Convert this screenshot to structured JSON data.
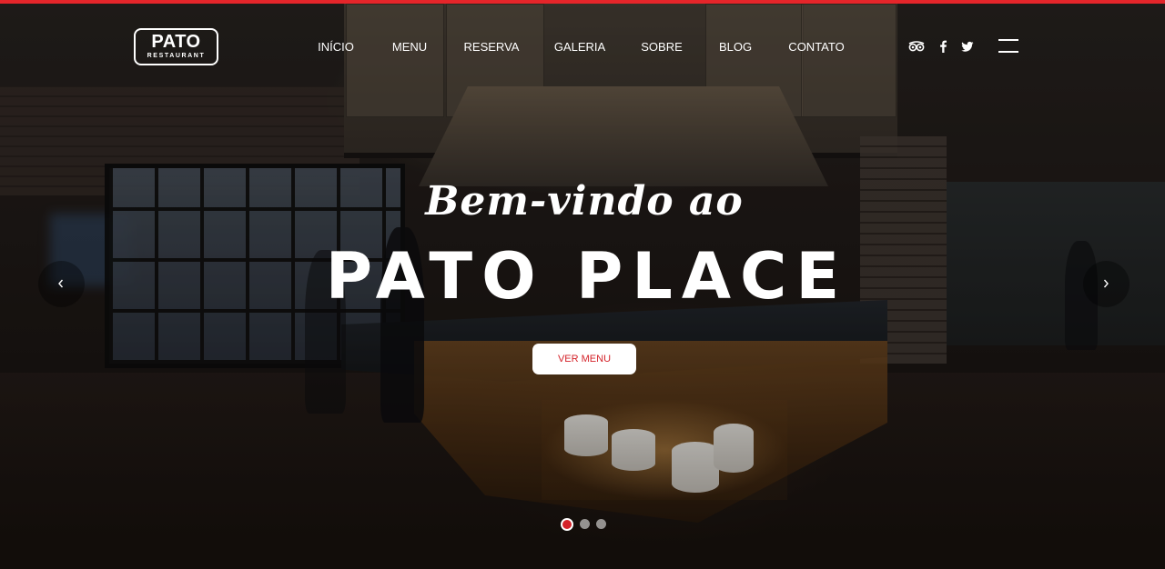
{
  "brand": {
    "name": "PATO",
    "tagline": "RESTAURANT"
  },
  "nav": {
    "items": [
      "INÍCIO",
      "MENU",
      "RESERVA",
      "GALERIA",
      "SOBRE",
      "BLOG",
      "CONTATO"
    ]
  },
  "social": {
    "icons": [
      "tripadvisor-icon",
      "facebook-icon",
      "twitter-icon"
    ]
  },
  "hero": {
    "welcome": "Bem-vindo ao",
    "title": "PATO PLACE",
    "cta_label": "VER MENU"
  },
  "slider": {
    "slide_count": 3,
    "active_slide": 1
  },
  "colors": {
    "accent": "#d4232a",
    "top_bar": "#e5252a",
    "text": "#ffffff"
  }
}
